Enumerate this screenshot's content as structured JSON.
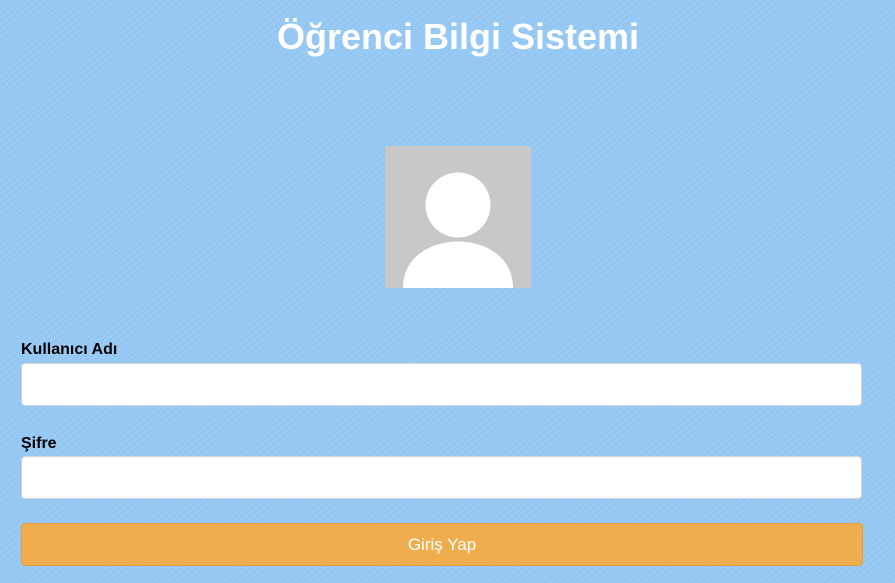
{
  "page": {
    "title": "Öğrenci Bilgi Sistemi"
  },
  "avatar": {
    "icon": "user-avatar-placeholder-icon"
  },
  "login_form": {
    "username_label": "Kullanıcı Adı",
    "username_value": "",
    "password_label": "Şifre",
    "password_value": "",
    "submit_label": "Giriş Yap"
  },
  "colors": {
    "background": "#97c9f5",
    "title_text": "#ffffff",
    "avatar_background": "#c8c8c9",
    "submit_button": "#f0ad4e"
  }
}
